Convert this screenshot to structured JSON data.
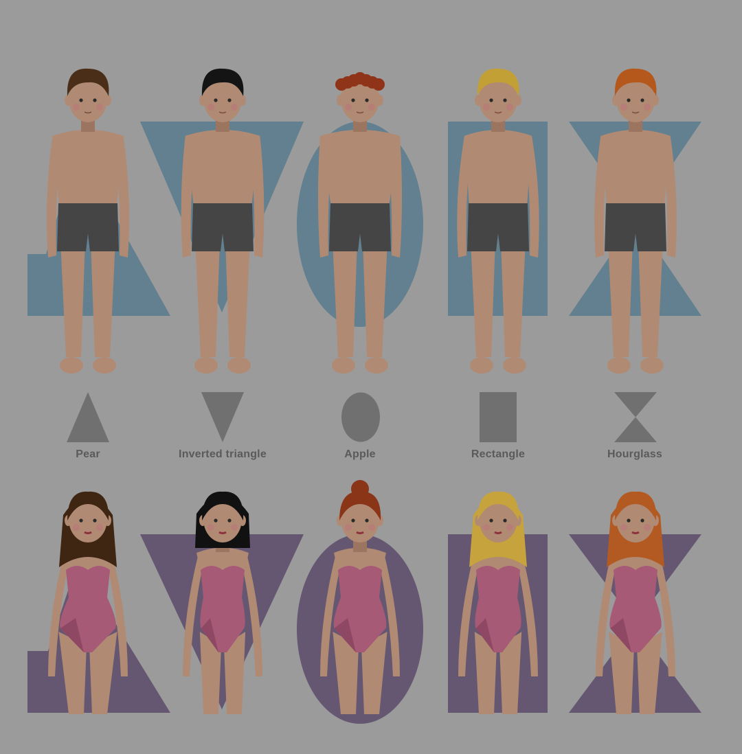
{
  "colors": {
    "background": "#9b9b9b",
    "male_shape": "#62808f",
    "female_shape": "#655771",
    "icon": "#707070",
    "label": "#5a5a5a",
    "skin": "#b08a73",
    "skin_shade": "#9c7561",
    "shorts": "#454545",
    "swimsuit": "#a65a76",
    "swimsuit_shade": "#8e4863"
  },
  "body_types": [
    {
      "name": "Pear",
      "shape": "triangle",
      "icon": "triangle-icon",
      "male_hair": "#4a2e17",
      "female_hair": "#3e2613"
    },
    {
      "name": "Inverted triangle",
      "shape": "inverted-triangle",
      "icon": "inverted-triangle-icon",
      "male_hair": "#141414",
      "female_hair": "#111111"
    },
    {
      "name": "Apple",
      "shape": "oval",
      "icon": "oval-icon",
      "male_hair": "#8f3418",
      "female_hair": "#8a3418"
    },
    {
      "name": "Rectangle",
      "shape": "rectangle",
      "icon": "rectangle-icon",
      "male_hair": "#c2a036",
      "female_hair": "#c6a33c"
    },
    {
      "name": "Hourglass",
      "shape": "hourglass",
      "icon": "hourglass-icon",
      "male_hair": "#b4581c",
      "female_hair": "#b25a22"
    }
  ]
}
